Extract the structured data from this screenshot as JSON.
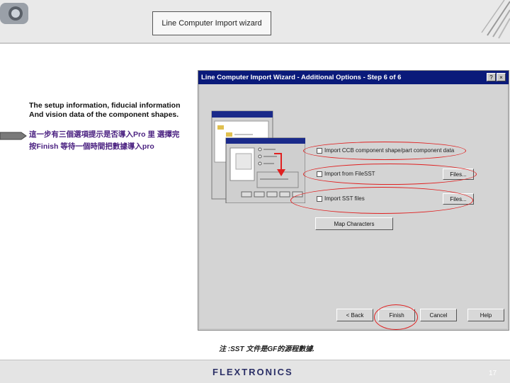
{
  "slide": {
    "title": "Line Computer Import wizard",
    "setup_text_1": "The setup information, fiducial information",
    "setup_text_2": "And vision data of the component shapes.",
    "cn_text_1": "這一步有三個選項提示是否導入Pro 里 選擇完",
    "cn_text_2": "按Finish 等待一個時間把數據導入pro",
    "footnote": "注 :SST 文件是GF的源程數據.",
    "brand": "FLEXTRONICS",
    "page_number": "17"
  },
  "wizard": {
    "title": "Line Computer Import Wizard - Additional Options - Step 6 of 6",
    "close_glyph": "×",
    "question_glyph": "?",
    "options": [
      {
        "label": "Import CCB component shape/part component data",
        "checked": false
      },
      {
        "label": "Import from FileSST",
        "checked": false,
        "button": "Files..."
      },
      {
        "label": "Import SST files",
        "checked": false,
        "button": "Files..."
      }
    ],
    "map_button": "Map Characters",
    "buttons": {
      "back": "< Back",
      "finish": "Finish",
      "cancel": "Cancel",
      "help": "Help"
    }
  },
  "colors": {
    "highlight": "#e02020",
    "titlebar": "#0a1a7a",
    "brand": "#2b2f66"
  }
}
